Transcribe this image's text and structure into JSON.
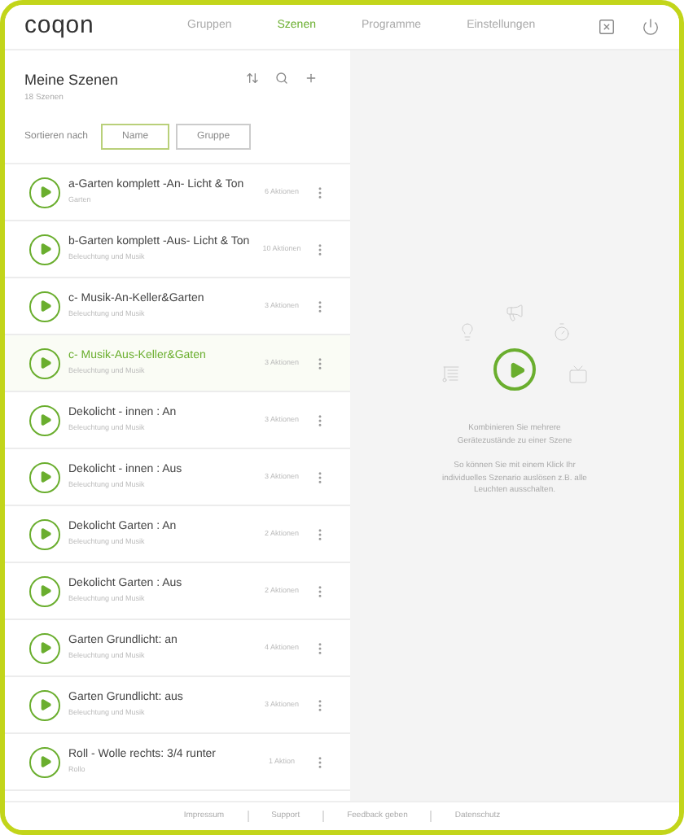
{
  "nav": {
    "logo": "coqon",
    "tabs": [
      {
        "label": "Gruppen",
        "selected": false
      },
      {
        "label": "Szenen",
        "selected": true
      },
      {
        "label": "Programme",
        "selected": false
      },
      {
        "label": "Einstellungen",
        "selected": false
      }
    ]
  },
  "panel": {
    "title": "Meine Szenen",
    "subtitle": "18 Szenen",
    "sort_label": "Sortieren nach",
    "sort_options": [
      {
        "label": "Name",
        "selected": true
      },
      {
        "label": "Gruppe",
        "selected": false
      }
    ]
  },
  "scenes": [
    {
      "name": "a-Garten komplett -An- Licht & Ton",
      "group": "Garten",
      "actions": "6 Aktionen",
      "selected": false
    },
    {
      "name": "b-Garten komplett -Aus- Licht & Ton",
      "group": "Beleuchtung und Musik",
      "actions": "10 Aktionen",
      "selected": false
    },
    {
      "name": "c- Musik-An-Keller&Garten",
      "group": "Beleuchtung und Musik",
      "actions": "3 Aktionen",
      "selected": false
    },
    {
      "name": "c- Musik-Aus-Keller&Gaten",
      "group": "Beleuchtung und Musik",
      "actions": "3 Aktionen",
      "selected": true
    },
    {
      "name": "Dekolicht - innen : An",
      "group": "Beleuchtung und Musik",
      "actions": "3 Aktionen",
      "selected": false
    },
    {
      "name": "Dekolicht - innen : Aus",
      "group": "Beleuchtung und Musik",
      "actions": "3 Aktionen",
      "selected": false
    },
    {
      "name": "Dekolicht Garten : An",
      "group": "Beleuchtung und Musik",
      "actions": "2 Aktionen",
      "selected": false
    },
    {
      "name": "Dekolicht Garten : Aus",
      "group": "Beleuchtung und Musik",
      "actions": "2 Aktionen",
      "selected": false
    },
    {
      "name": "Garten Grundlicht: an",
      "group": "Beleuchtung und Musik",
      "actions": "4 Aktionen",
      "selected": false
    },
    {
      "name": "Garten Grundlicht: aus",
      "group": "Beleuchtung und Musik",
      "actions": "3 Aktionen",
      "selected": false
    },
    {
      "name": "Roll - Wolle rechts: 3/4 runter",
      "group": "Rollo",
      "actions": "1 Aktion",
      "selected": false
    }
  ],
  "empty_state": {
    "line_1": "Kombinieren Sie mehrere Gerätezustände zu einer Szene",
    "line_2": "So können Sie mit einem Klick Ihr individuelles Szenario auslösen z.B. alle Leuchten ausschalten."
  },
  "footer": [
    "Impressum",
    "Support",
    "Feedback geben",
    "Datenschutz"
  ]
}
